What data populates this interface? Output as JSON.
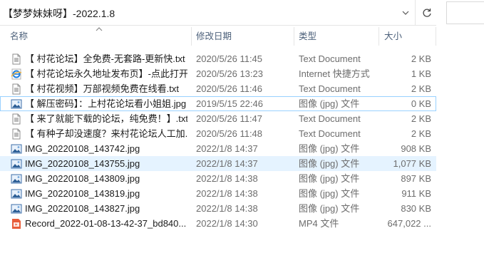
{
  "address": {
    "path": "【梦梦妹妹呀】-2022.1.8"
  },
  "columns": {
    "name": "名称",
    "date": "修改日期",
    "type": "类型",
    "size": "大小"
  },
  "files": [
    {
      "name": "【 村花论坛】全免费-无套路-更新快.txt",
      "date": "2020/5/26 11:45",
      "type": "Text Document",
      "size": "2 KB",
      "icon": "text-file-icon"
    },
    {
      "name": "【 村花论坛永久地址发布页】-点此打开",
      "date": "2020/5/26 13:23",
      "type": "Internet 快捷方式",
      "size": "1 KB",
      "icon": "internet-shortcut-icon"
    },
    {
      "name": "【 村花视频】万部视频免费在线看.txt",
      "date": "2020/5/26 11:46",
      "type": "Text Document",
      "size": "2 KB",
      "icon": "text-file-icon"
    },
    {
      "name": "【 解压密码】：上村花论坛看小姐姐.jpg",
      "date": "2019/5/15 22:46",
      "type": "图像 (jpg) 文件",
      "size": "0 KB",
      "icon": "image-file-icon"
    },
    {
      "name": "【 来了就能下载的论坛，纯免费！】.txt",
      "date": "2020/5/26 11:47",
      "type": "Text Document",
      "size": "2 KB",
      "icon": "text-file-icon"
    },
    {
      "name": "【 有种子却没速度？来村花论坛人工加...",
      "date": "2020/5/26 11:48",
      "type": "Text Document",
      "size": "2 KB",
      "icon": "text-file-icon"
    },
    {
      "name": "IMG_20220108_143742.jpg",
      "date": "2022/1/8 14:37",
      "type": "图像 (jpg) 文件",
      "size": "908 KB",
      "icon": "image-file-icon"
    },
    {
      "name": "IMG_20220108_143755.jpg",
      "date": "2022/1/8 14:37",
      "type": "图像 (jpg) 文件",
      "size": "1,077 KB",
      "icon": "image-file-icon"
    },
    {
      "name": "IMG_20220108_143809.jpg",
      "date": "2022/1/8 14:38",
      "type": "图像 (jpg) 文件",
      "size": "897 KB",
      "icon": "image-file-icon"
    },
    {
      "name": "IMG_20220108_143819.jpg",
      "date": "2022/1/8 14:38",
      "type": "图像 (jpg) 文件",
      "size": "911 KB",
      "icon": "image-file-icon"
    },
    {
      "name": "IMG_20220108_143827.jpg",
      "date": "2022/1/8 14:38",
      "type": "图像 (jpg) 文件",
      "size": "830 KB",
      "icon": "image-file-icon"
    },
    {
      "name": "Record_2022-01-08-13-42-37_bd840...",
      "date": "2022/1/8 14:30",
      "type": "MP4 文件",
      "size": "647,022 ...",
      "icon": "video-file-icon"
    }
  ],
  "selected_row": 7,
  "focused_row": 3,
  "colors": {
    "selection": "#e5f3ff",
    "focus_border": "#99d1ff",
    "header_text": "#4c607a",
    "meta_text": "#6d6d6d"
  }
}
